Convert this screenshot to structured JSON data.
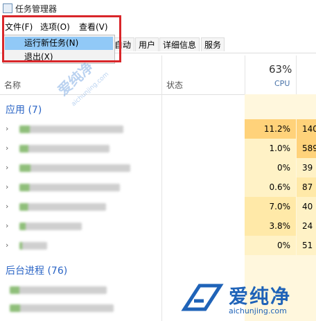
{
  "window": {
    "title": "任务管理器"
  },
  "menu": {
    "file": "文件(F)",
    "options": "选项(O)",
    "view": "查看(V)"
  },
  "file_menu": {
    "items": [
      "运行新任务(N)",
      "退出(X)"
    ]
  },
  "tabs": [
    "自动",
    "用户",
    "详细信息",
    "服务"
  ],
  "columns": {
    "name": "名称",
    "status": "状态",
    "cpu_percent": "63%",
    "cpu": "CPU"
  },
  "groups": {
    "apps": "应用 (7)",
    "background": "后台进程 (76)"
  },
  "rows": [
    {
      "cpu": "11.2%",
      "mem": "140"
    },
    {
      "cpu": "1.0%",
      "mem": "589"
    },
    {
      "cpu": "0%",
      "mem": "39"
    },
    {
      "cpu": "0.6%",
      "mem": "87"
    },
    {
      "cpu": "7.0%",
      "mem": "40"
    },
    {
      "cpu": "3.8%",
      "mem": "24"
    },
    {
      "cpu": "0%",
      "mem": "51"
    }
  ],
  "watermark": {
    "brand": "爱纯净",
    "site": "aichunjing.com"
  },
  "colors": {
    "highlight": "#91c9f7",
    "annotation": "#d9262a",
    "group": "#2a64c5"
  }
}
